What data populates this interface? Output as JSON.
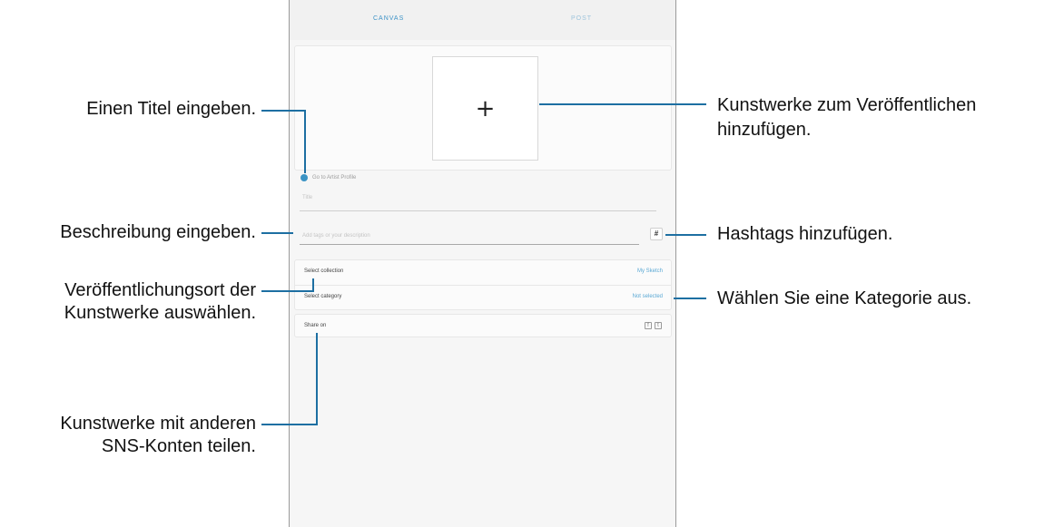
{
  "app": {
    "tabs": [
      {
        "label": "CANVAS"
      },
      {
        "label": "POST"
      }
    ],
    "add_artwork_icon": "plus-icon",
    "small_label": "Go to Artist Profile",
    "title_placeholder": "Title",
    "description_placeholder": "Add tags or your description",
    "hashtag_button_label": "#",
    "select_collection": {
      "label": "Select collection",
      "value": "My Sketch"
    },
    "select_category": {
      "label": "Select category",
      "value": "Not selected"
    },
    "share": {
      "label": "Share on",
      "icons": [
        "facebook-icon",
        "twitter-icon"
      ]
    }
  },
  "callouts": {
    "enter_title": "Einen Titel eingeben.",
    "enter_description": "Beschreibung eingeben.",
    "select_location_line1": "Veröffentlichungsort der",
    "select_location_line2": "Kunstwerke auswählen.",
    "share_line1": "Kunstwerke mit anderen",
    "share_line2": "SNS-Konten teilen.",
    "add_artwork_line1": "Kunstwerke zum Veröffentlichen",
    "add_artwork_line2": "hinzufügen.",
    "add_hashtags": "Hashtags hinzufügen.",
    "select_category": "Wählen Sie eine Kategorie aus."
  },
  "colors": {
    "accent": "#1d6fa2",
    "link": "#5aa8d4",
    "background": "#f6f6f6"
  }
}
